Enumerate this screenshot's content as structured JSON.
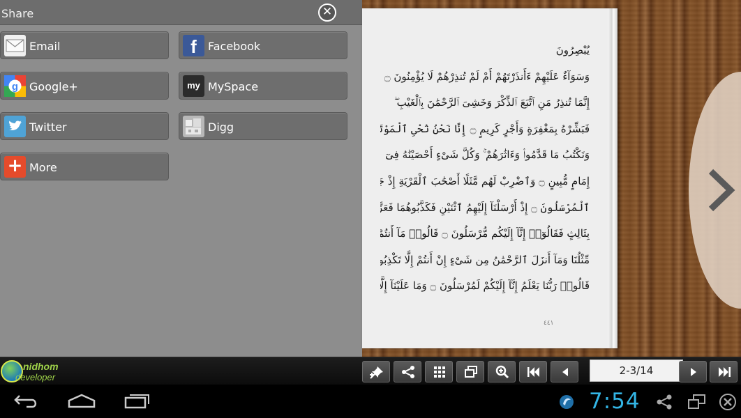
{
  "share": {
    "title": "Share",
    "close_icon": "close-circle-icon",
    "options": {
      "email": {
        "label": "Email",
        "icon": "email-icon"
      },
      "facebook": {
        "label": "Facebook",
        "icon": "facebook-icon",
        "glyph": "f"
      },
      "google": {
        "label": "Google+",
        "icon": "google-icon",
        "glyph": "g"
      },
      "myspace": {
        "label": "MySpace",
        "icon": "myspace-icon",
        "glyph": "my"
      },
      "twitter": {
        "label": "Twitter",
        "icon": "twitter-icon"
      },
      "digg": {
        "label": "Digg",
        "icon": "digg-icon"
      },
      "more": {
        "label": "More",
        "icon": "plus-icon",
        "glyph": "+"
      }
    }
  },
  "book": {
    "lines": [
      "يُبْصِرُونَ",
      "وَسَوَآءٌ عَلَيْهِمْ ءَأَنذَرْتَهُمْ أَمْ لَمْ تُنذِرْهُمْ لَا يُؤْمِنُونَ ۝",
      "إِنَّمَا تُنذِرُ مَنِ ٱتَّبَعَ ٱلذِّكْرَ وَخَشِىَ ٱلرَّحْمَٰنَ بِٱلْغَيْبِ ۖ",
      "فَبَشِّرْهُ بِمَغْفِرَةٍ وَأَجْرٍ كَرِيمٍ ۝ إِنَّا نَحْنُ نُحْىِ ٱلْمَوْتَىٰ",
      "وَنَكْتُبُ مَا قَدَّمُوا۟ وَءَاثَٰرَهُمْ ۚ وَكُلَّ شَىْءٍ أَحْصَيْنَٰهُ فِىٓ",
      "إِمَامٍ مُّبِينٍ ۝ وَٱضْرِبْ لَهُم مَّثَلًا أَصْحَٰبَ ٱلْقَرْيَةِ إِذْ جَآءَهَا",
      "ٱلْمُرْسَلُونَ ۝ إِذْ أَرْسَلْنَآ إِلَيْهِمُ ٱثْنَيْنِ فَكَذَّبُوهُمَا فَعَزَّزْنَا",
      "بِثَالِثٍ فَقَالُوٓا۟ إِنَّآ إِلَيْكُم مُّرْسَلُونَ ۝ قَالُوا۟ مَآ أَنتُمْ إِلَّا بَشَرٌ",
      "مِّثْلُنَا وَمَآ أَنزَلَ ٱلرَّحْمَٰنُ مِن شَىْءٍ إِنْ أَنتُمْ إِلَّا تَكْذِبُونَ ۝",
      "قَالُوا۟ رَبُّنَا يَعْلَمُ إِنَّآ إِلَيْكُمْ لَمُرْسَلُونَ ۝ وَمَا عَلَيْنَآ إِلَّا"
    ],
    "footer": "٤٤١"
  },
  "logo": {
    "line1": "nidhom",
    "line2": "developer"
  },
  "toolbar": {
    "buttons": [
      "pin-icon",
      "share-icon",
      "grid-icon",
      "windows-icon",
      "zoom-icon",
      "first-page-icon",
      "prev-page-icon",
      "next-page-icon",
      "last-page-icon"
    ],
    "page_indicator": "2-3/14"
  },
  "navbar": {
    "buttons": [
      "back-icon",
      "home-icon",
      "recent-apps-icon"
    ],
    "clock": "7:54",
    "status_icons": [
      "app-notification-icon",
      "share-icon",
      "screen-icon",
      "close-circle-icon"
    ]
  },
  "colors": {
    "clock": "#33b5e5",
    "panel": "#8d8d8d",
    "button": "#6e6e6e",
    "logo": "#9fd34a"
  }
}
